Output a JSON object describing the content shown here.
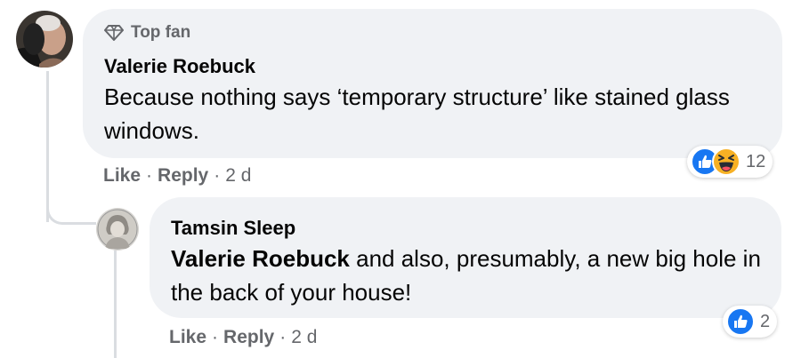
{
  "comments": [
    {
      "badge": "Top fan",
      "author": "Valerie Roebuck",
      "body": "Because nothing says ‘temporary structure’ like stained glass windows.",
      "reaction_count": "12",
      "reactions": [
        "like-icon",
        "haha-icon"
      ],
      "actions": {
        "like": "Like",
        "reply": "Reply",
        "time": "2 d"
      },
      "sep": "·"
    },
    {
      "author": "Tamsin Sleep",
      "mention": "Valerie Roebuck",
      "body": " and also, presumably, a new big hole in the back of your house!",
      "reaction_count": "2",
      "reactions": [
        "like-icon"
      ],
      "actions": {
        "like": "Like",
        "reply": "Reply",
        "time": "2 d"
      },
      "sep": "·"
    }
  ],
  "colors": {
    "bubble": "#f0f2f5",
    "meta": "#65676b",
    "like_blue": "#1877f2",
    "haha_yellow": "#f7b125"
  }
}
